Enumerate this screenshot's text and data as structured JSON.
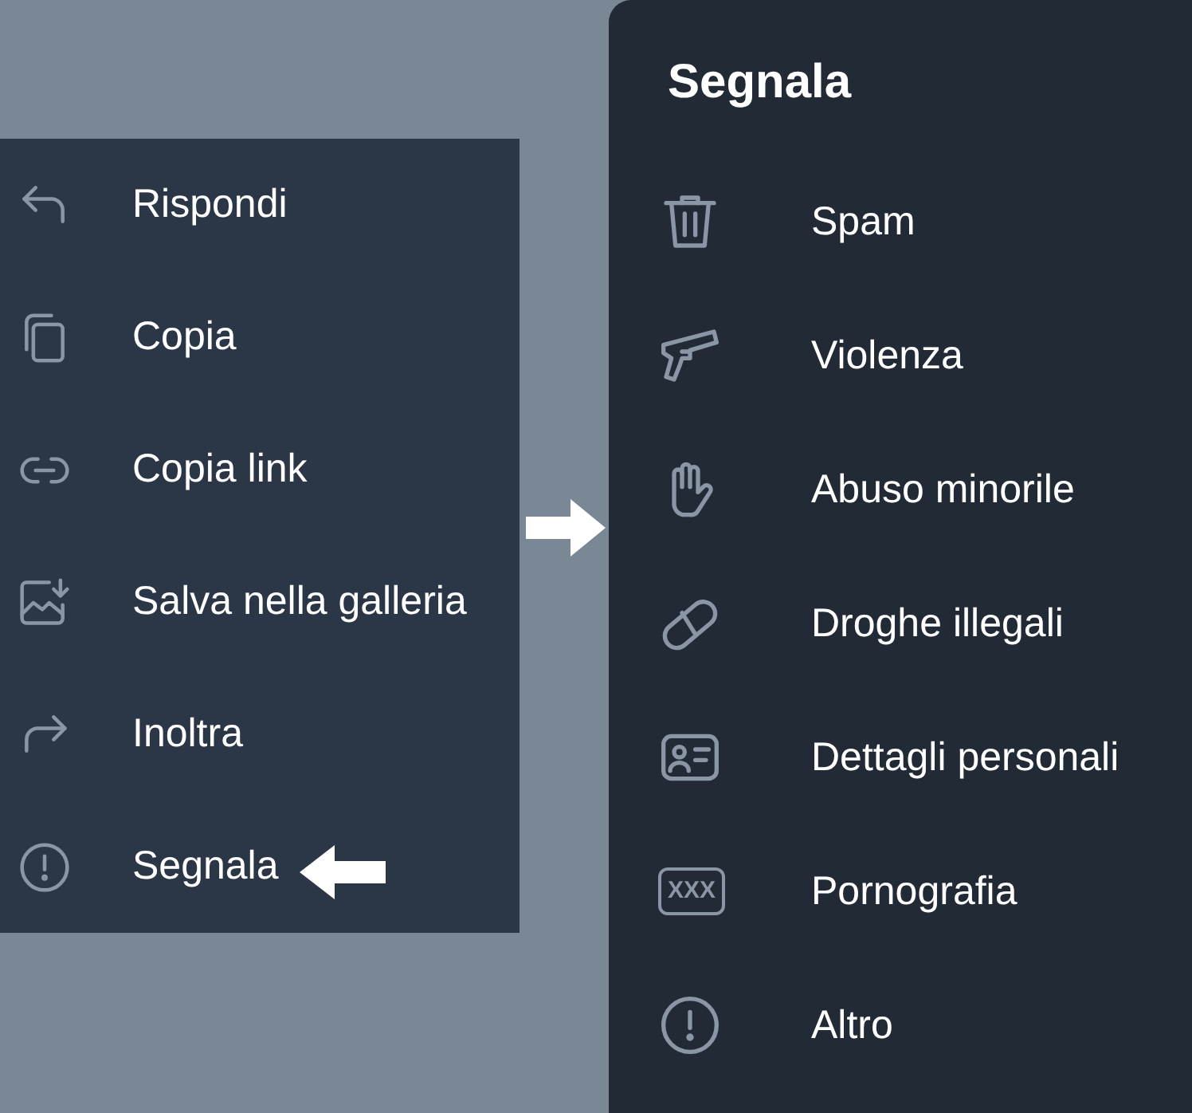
{
  "message_menu": {
    "items": [
      {
        "label": "Rispondi",
        "kind": "reply"
      },
      {
        "label": "Copia",
        "kind": "copy"
      },
      {
        "label": "Copia link",
        "kind": "link"
      },
      {
        "label": "Salva nella galleria",
        "kind": "save-image"
      },
      {
        "label": "Inoltra",
        "kind": "forward"
      },
      {
        "label": "Segnala",
        "kind": "alert"
      }
    ]
  },
  "report_panel": {
    "title": "Segnala",
    "items": [
      {
        "label": "Spam",
        "kind": "trash"
      },
      {
        "label": "Violenza",
        "kind": "gun"
      },
      {
        "label": "Abuso minorile",
        "kind": "hand"
      },
      {
        "label": "Droghe illegali",
        "kind": "pill"
      },
      {
        "label": "Dettagli personali",
        "kind": "id-card"
      },
      {
        "label": "Pornografia",
        "kind": "tag",
        "badge": "XXX"
      },
      {
        "label": "Altro",
        "kind": "alert"
      }
    ]
  }
}
